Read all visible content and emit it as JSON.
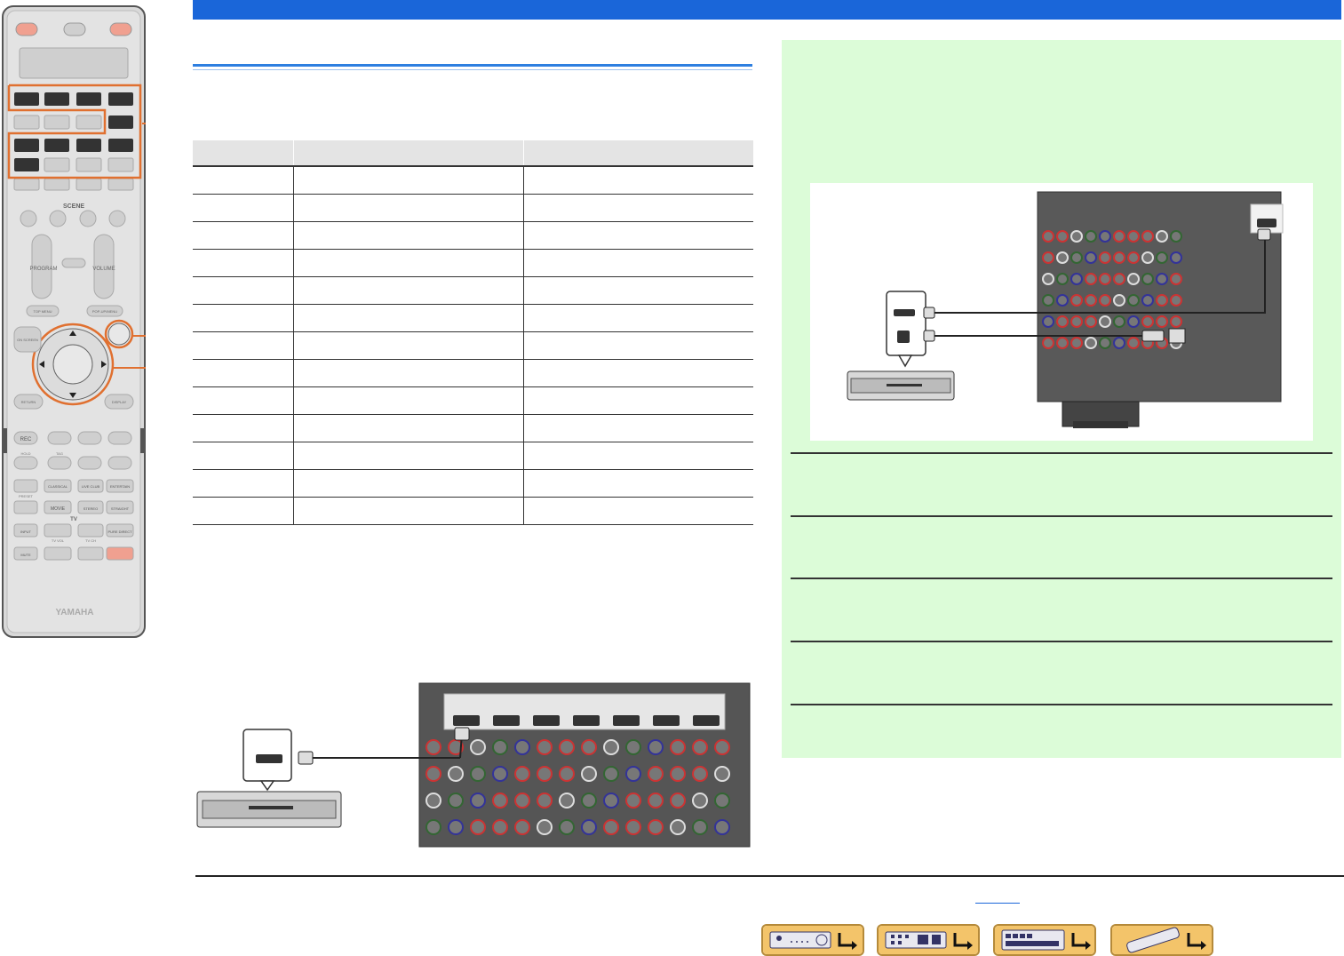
{
  "palette": {
    "blue_bar": "#1a66d9",
    "panel_green": "#dcfcd8",
    "callout_orange": "#e07030",
    "table_header": "#e4e4e4",
    "nav_gold": "#f3c46a"
  },
  "remote": {
    "scene_label": "SCENE",
    "program_label": "PROGRAM",
    "volume_label": "VOLUME",
    "top_menu": "TOP MENU",
    "popup_menu": "POP-UP/MENU",
    "on_screen": "ON SCREEN",
    "return": "RETURN",
    "display": "DISPLAY",
    "rec": "REC",
    "hold": "HOLD",
    "tag": "TAG",
    "pure_direct_top": "PURE",
    "preset": "PRESET",
    "classical": "CLASSICAL",
    "live_club": "LIVE CLUB",
    "entertain": "ENTERTAIN",
    "movie": "MOVIE",
    "stereo": "STEREO",
    "straight": "STRAIGHT",
    "tv": "TV",
    "input": "INPUT",
    "tv_vol": "TV VOL",
    "tv_ch": "TV CH",
    "pure_direct": "PURE DIRECT",
    "mute": "MUTE",
    "brand": "YAMAHA",
    "scene_numbers": [
      "1",
      "2",
      "3",
      "4"
    ]
  },
  "table": {
    "rows": 13
  },
  "icons": {
    "player": "disc-player-icon",
    "receiver": "receiver-rear-panel-icon",
    "nav": [
      "front-panel-icon",
      "rear-panel-icon",
      "display-icon",
      "remote-icon"
    ]
  }
}
